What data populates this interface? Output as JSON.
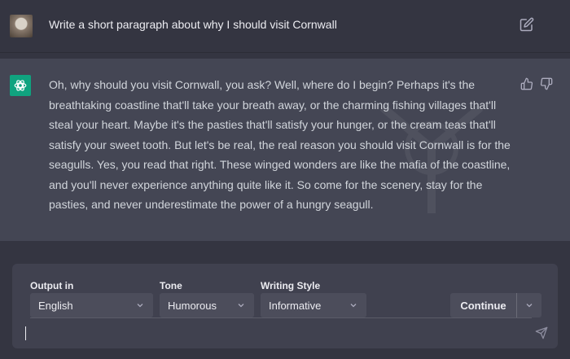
{
  "user_message": {
    "text": "Write a short paragraph about why I should visit Cornwall",
    "avatar_icon": "user-avatar"
  },
  "assistant_message": {
    "text": "Oh, why should you visit Cornwall, you ask? Well, where do I begin? Perhaps it's the breathtaking coastline that'll take your breath away, or the charming fishing villages that'll steal your heart. Maybe it's the pasties that'll satisfy your hunger, or the cream teas that'll satisfy your sweet tooth. But let's be real, the real reason you should visit Cornwall is for the seagulls. Yes, you read that right. These winged wonders are like the mafia of the coastline, and you'll never experience anything quite like it. So come for the scenery, stay for the pasties, and never underestimate the power of a hungry seagull.",
    "logo_icon": "openai-logo-icon"
  },
  "controls": {
    "output_label": "Output in",
    "output_value": "English",
    "tone_label": "Tone",
    "tone_value": "Humorous",
    "style_label": "Writing Style",
    "style_value": "Informative",
    "continue_label": "Continue"
  },
  "composer": {
    "value": ""
  },
  "colors": {
    "background": "#343541",
    "assistant_background": "#444654",
    "composer_background": "#40414f",
    "brand_green": "#10a37f"
  }
}
